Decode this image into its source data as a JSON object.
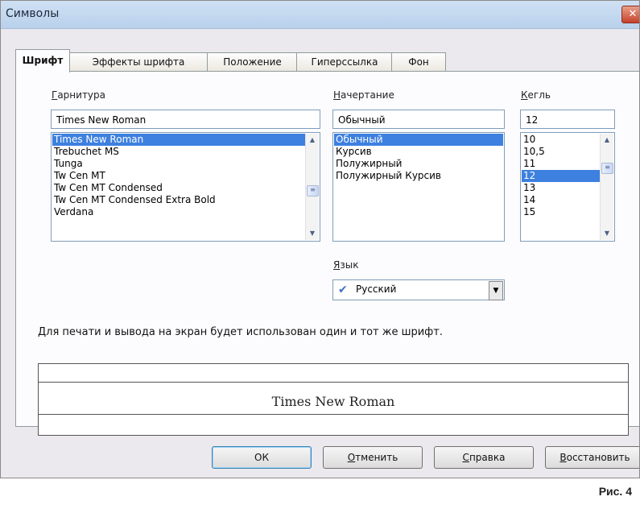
{
  "window": {
    "title": "Символы",
    "close_glyph": "✕"
  },
  "tabs": [
    {
      "label": "Шрифт",
      "active": true
    },
    {
      "label": "Эффекты шрифта",
      "active": false
    },
    {
      "label": "Положение",
      "active": false
    },
    {
      "label": "Гиперссылка",
      "active": false
    },
    {
      "label": "Фон",
      "active": false
    }
  ],
  "font_family": {
    "label_accesskey": "Г",
    "label_rest": "арнитура",
    "value": "Times New Roman",
    "items": [
      "Times New Roman",
      "Trebuchet MS",
      "Tunga",
      "Tw Cen MT",
      "Tw Cen MT Condensed",
      "Tw Cen MT Condensed Extra Bold",
      "Verdana"
    ],
    "selected": "Times New Roman"
  },
  "font_style": {
    "label_accesskey": "Н",
    "label_rest": "ачертание",
    "value": "Обычный",
    "items": [
      "Обычный",
      "Курсив",
      "Полужирный",
      "Полужирный Курсив"
    ],
    "selected": "Обычный"
  },
  "font_size": {
    "label_accesskey": "К",
    "label_rest": "егль",
    "value": "12",
    "items": [
      "10",
      "10,5",
      "11",
      "12",
      "13",
      "14",
      "15"
    ],
    "selected": "12"
  },
  "language": {
    "label_accesskey": "Я",
    "label_rest": "зык",
    "value": "Русский",
    "icon": "spellcheck-icon"
  },
  "info_text": "Для печати и вывода на экран будет использован один и тот же шрифт.",
  "preview_text": "Times New Roman",
  "buttons": {
    "ok": "ОК",
    "cancel_accesskey": "О",
    "cancel_rest": "тменить",
    "help_accesskey": "С",
    "help_rest": "правка",
    "reset_accesskey": "В",
    "reset_rest": "осстановить"
  },
  "caption": "Рис. 4",
  "colors": {
    "selection": "#3d80df",
    "titlebar": "#cfe0f3"
  }
}
